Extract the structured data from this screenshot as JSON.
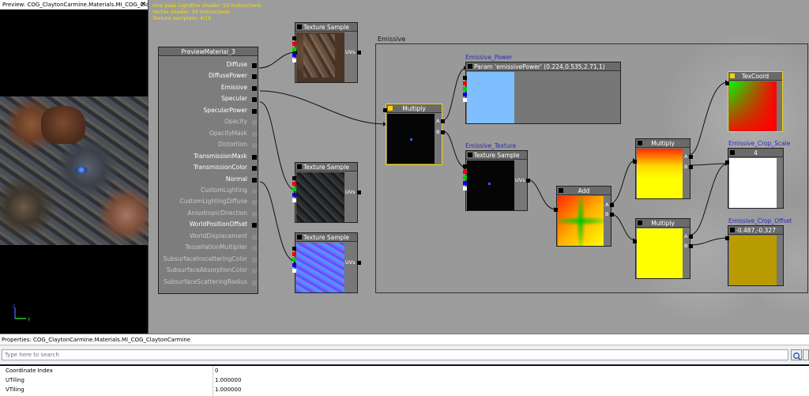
{
  "preview": {
    "title": "Preview: COG_ClaytonCarmine.Materials.MI_COG_ClaytonCa...",
    "close_glyph": "✕",
    "axis_labels": {
      "z": "z",
      "y": "y"
    }
  },
  "stats": [
    "One pass LightEnv shader: 53 instructions",
    "Vertex shader: 33 instructions",
    "Texture samplers: 4/16"
  ],
  "comment": {
    "title": "Emissive"
  },
  "material_node": {
    "title": "PreviewMaterial_3",
    "inputs": [
      {
        "label": "Diffuse",
        "connected": true
      },
      {
        "label": "DiffusePower",
        "connected": true
      },
      {
        "label": "Emissive",
        "connected": true
      },
      {
        "label": "Specular",
        "connected": true
      },
      {
        "label": "SpecularPower",
        "connected": true
      },
      {
        "label": "Opacity",
        "connected": false
      },
      {
        "label": "OpacityMask",
        "connected": false
      },
      {
        "label": "Distortion",
        "connected": false
      },
      {
        "label": "TransmissionMask",
        "connected": true
      },
      {
        "label": "TransmissionColor",
        "connected": true
      },
      {
        "label": "Normal",
        "connected": true
      },
      {
        "label": "CustomLighting",
        "connected": false
      },
      {
        "label": "CustomLightingDiffuse",
        "connected": false
      },
      {
        "label": "AnisotropicDirection",
        "connected": false
      },
      {
        "label": "WorldPositionOffset",
        "connected": true
      },
      {
        "label": "WorldDisplacement",
        "connected": false
      },
      {
        "label": "TessellationMultiplier",
        "connected": false
      },
      {
        "label": "SubsurfaceInscatteringColor",
        "connected": false
      },
      {
        "label": "SubsurfaceAbsorptionColor",
        "connected": false
      },
      {
        "label": "SubsurfaceScatteringRadius",
        "connected": false
      }
    ]
  },
  "nodes": {
    "tex_diffuse": {
      "title": "Texture Sample",
      "uv_label": "UVs"
    },
    "tex_specular": {
      "title": "Texture Sample",
      "uv_label": "UVs"
    },
    "tex_normal": {
      "title": "Texture Sample",
      "uv_label": "UVs"
    },
    "multiply_main": {
      "title": "Multiply",
      "a": "A",
      "b": "B"
    },
    "emissive_power": {
      "param_name": "Emissive_Power",
      "title": "Param 'emissivePower' (0.224,0.535,2.71,1)"
    },
    "emissive_texture": {
      "param_name": "Emissive_Texture",
      "title": "Texture Sample",
      "uv_label": "UVs"
    },
    "add": {
      "title": "Add",
      "a": "A",
      "b": "B"
    },
    "multiply_top": {
      "title": "Multiply",
      "a": "A",
      "b": "B"
    },
    "multiply_bottom": {
      "title": "Multiply",
      "a": "A",
      "b": "B"
    },
    "texcoord": {
      "title": "TexCoord"
    },
    "crop_scale": {
      "param_name": "Emissive_Crop_Scale",
      "title": "4"
    },
    "crop_offset": {
      "param_name": "Emissive_Crop_Offset",
      "title": "-0.487,-0.327"
    }
  },
  "colors": {
    "selected": "#f2d40a",
    "param_text": "#2b2bb8",
    "emissive_power_color": "#7fbfff",
    "crop_offset_color": "#b89b00"
  },
  "properties": {
    "title": "Properties: COG_ClaytonCarmine.Materials.MI_COG_ClaytonCarmine",
    "search_placeholder": "Type here to search",
    "search_icon": "magnifier-icon",
    "rows": [
      {
        "name": "Coordinate Index",
        "value": "0"
      },
      {
        "name": "UTiling",
        "value": "1.000000"
      },
      {
        "name": "VTiling",
        "value": "1.000000"
      }
    ]
  }
}
